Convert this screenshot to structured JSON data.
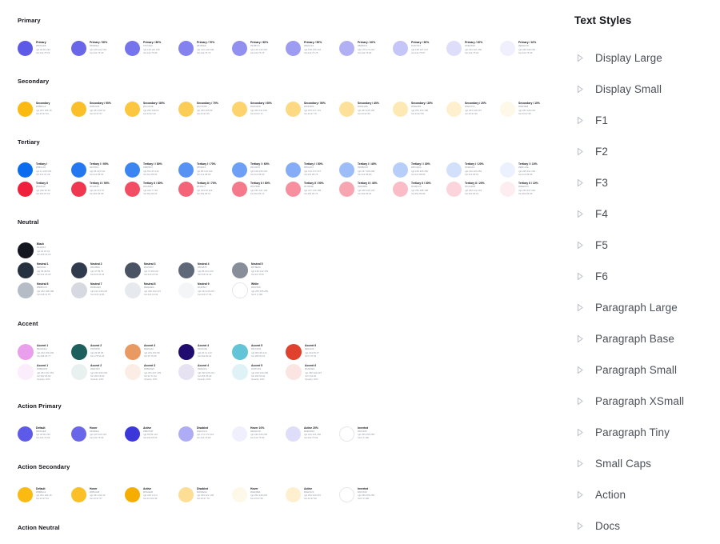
{
  "panels": {
    "text_styles": {
      "title": "Text Styles",
      "caret_icon": "triangle-right-icon",
      "items": [
        {
          "label": "Display Large"
        },
        {
          "label": "Display Small"
        },
        {
          "label": "F1"
        },
        {
          "label": "F2"
        },
        {
          "label": "F3"
        },
        {
          "label": "F4"
        },
        {
          "label": "F5"
        },
        {
          "label": "F6"
        },
        {
          "label": "Paragraph Large"
        },
        {
          "label": "Paragraph Base"
        },
        {
          "label": "Paragraph Small"
        },
        {
          "label": "Paragraph XSmall"
        },
        {
          "label": "Paragraph Tiny"
        },
        {
          "label": "Small Caps"
        },
        {
          "label": "Action"
        },
        {
          "label": "Docs"
        }
      ]
    }
  },
  "color_sections": [
    {
      "title": "Primary",
      "rows": [
        [
          {
            "name": "Primary",
            "hex": "#5D5AE8",
            "rgb": "rgb 93 90 232",
            "hsl": "hsl 242 75 63"
          },
          {
            "name": "Primary / 90%",
            "hex": "#6966EA",
            "rgb": "rgb 105 102 234",
            "hsl": "hsl 242 75 66"
          },
          {
            "name": "Primary / 80%",
            "hex": "#7674EC",
            "rgb": "rgb 118 116 236",
            "hsl": "hsl 242 75 69"
          },
          {
            "name": "Primary / 70%",
            "hex": "#8482EE",
            "rgb": "rgb 132 130 238",
            "hsl": "hsl 242 75 72"
          },
          {
            "name": "Primary / 60%",
            "hex": "#918FF0",
            "rgb": "rgb 145 143 240",
            "hsl": "hsl 242 75 75"
          },
          {
            "name": "Primary / 50%",
            "hex": "#9E9CF2",
            "rgb": "rgb 158 156 242",
            "hsl": "hsl 242 75 78"
          },
          {
            "name": "Primary / 40%",
            "hex": "#B2B0F4",
            "rgb": "rgb 178 176 244",
            "hsl": "hsl 242 75 82"
          },
          {
            "name": "Primary / 30%",
            "hex": "#C6C5F7",
            "rgb": "rgb 198 197 247",
            "hsl": "hsl 242 75 87"
          },
          {
            "name": "Primary / 20%",
            "hex": "#DEDDFA",
            "rgb": "rgb 222 221 250",
            "hsl": "hsl 242 75 92"
          },
          {
            "name": "Primary / 10%",
            "hex": "#EFEFFD",
            "rgb": "rgb 239 239 253",
            "hsl": "hsl 242 75 96"
          }
        ]
      ]
    },
    {
      "title": "Secondary",
      "rows": [
        [
          {
            "name": "Secondary",
            "hex": "#FBBA12",
            "rgb": "rgb 251 186 18",
            "hsl": "hsl 43 97 53"
          },
          {
            "name": "Secondary / 90%",
            "hex": "#FBC028",
            "rgb": "rgb 251 192 40",
            "hsl": "hsl 43 97 57"
          },
          {
            "name": "Secondary / 80%",
            "hex": "#FCC63E",
            "rgb": "rgb 252 198 62",
            "hsl": "hsl 43 97 62"
          },
          {
            "name": "Secondary / 70%",
            "hex": "#FCCD56",
            "rgb": "rgb 252 205 86",
            "hsl": "hsl 43 97 66"
          },
          {
            "name": "Secondary / 60%",
            "hex": "#FDD36D",
            "rgb": "rgb 253 211 109",
            "hsl": "hsl 43 97 71"
          },
          {
            "name": "Secondary / 50%",
            "hex": "#FDD983",
            "rgb": "rgb 253 217 131",
            "hsl": "hsl 43 97 75"
          },
          {
            "name": "Secondary / 40%",
            "hex": "#FDE19B",
            "rgb": "rgb 253 225 155",
            "hsl": "hsl 43 97 80"
          },
          {
            "name": "Secondary / 30%",
            "hex": "#FEE8B4",
            "rgb": "rgb 254 232 180",
            "hsl": "hsl 43 97 85"
          },
          {
            "name": "Secondary / 20%",
            "hex": "#FEF0CF",
            "rgb": "rgb 254 240 207",
            "hsl": "hsl 43 97 90"
          },
          {
            "name": "Secondary / 10%",
            "hex": "#FEF8E8",
            "rgb": "rgb 254 248 232",
            "hsl": "hsl 43 97 95"
          }
        ]
      ]
    },
    {
      "title": "Tertiary",
      "rows": [
        [
          {
            "name": "Tertiary I",
            "hex": "#0B6CF0",
            "rgb": "rgb 11 108 240",
            "hsl": "hsl 214 91 49"
          },
          {
            "name": "Tertiary I / 90%",
            "hex": "#2378F1",
            "rgb": "rgb 35 120 241",
            "hsl": "hsl 214 88 54"
          },
          {
            "name": "Tertiary I / 80%",
            "hex": "#3B85F3",
            "rgb": "rgb 59 133 243",
            "hsl": "hsl 214 88 59"
          },
          {
            "name": "Tertiary I / 70%",
            "hex": "#5592F4",
            "rgb": "rgb 85 146 244",
            "hsl": "hsl 214 88 65"
          },
          {
            "name": "Tertiary I / 60%",
            "hex": "#6C9FF5",
            "rgb": "rgb 108 159 245",
            "hsl": "hsl 214 88 69"
          },
          {
            "name": "Tertiary I / 50%",
            "hex": "#85ADF7",
            "rgb": "rgb 133 173 247",
            "hsl": "hsl 214 88 75"
          },
          {
            "name": "Tertiary I / 40%",
            "hex": "#9DBDF8",
            "rgb": "rgb 157 189 248",
            "hsl": "hsl 214 88 80"
          },
          {
            "name": "Tertiary I / 30%",
            "hex": "#B7CEFA",
            "rgb": "rgb 183 206 250",
            "hsl": "hsl 214 88 85"
          },
          {
            "name": "Tertiary I / 20%",
            "hex": "#D2E0FC",
            "rgb": "rgb 210 224 252",
            "hsl": "hsl 214 88 91"
          },
          {
            "name": "Tertiary I / 10%",
            "hex": "#EBF1FE",
            "rgb": "rgb 235 241 254",
            "hsl": "hsl 214 88 96"
          }
        ],
        [
          {
            "name": "Tertiary II",
            "hex": "#F0203C",
            "rgb": "rgb 240 32 60",
            "hsl": "hsl 352 87 53"
          },
          {
            "name": "Tertiary II / 90%",
            "hex": "#F1364F",
            "rgb": "rgb 241 54 79",
            "hsl": "hsl 352 86 58"
          },
          {
            "name": "Tertiary II / 80%",
            "hex": "#F24D63",
            "rgb": "rgb 242 77 99",
            "hsl": "hsl 352 86 63"
          },
          {
            "name": "Tertiary II / 70%",
            "hex": "#F46377",
            "rgb": "rgb 244 99 119",
            "hsl": "hsl 352 86 67"
          },
          {
            "name": "Tertiary II / 60%",
            "hex": "#F5798B",
            "rgb": "rgb 245 121 139",
            "hsl": "hsl 352 86 72"
          },
          {
            "name": "Tertiary II / 50%",
            "hex": "#F78F9E",
            "rgb": "rgb 247 143 158",
            "hsl": "hsl 352 86 76"
          },
          {
            "name": "Tertiary II / 40%",
            "hex": "#F8A5B2",
            "rgb": "rgb 248 165 178",
            "hsl": "hsl 352 86 81"
          },
          {
            "name": "Tertiary II / 30%",
            "hex": "#FABCC6",
            "rgb": "rgb 250 188 198",
            "hsl": "hsl 352 86 86"
          },
          {
            "name": "Tertiary II / 20%",
            "hex": "#FCD4DB",
            "rgb": "rgb 252 212 219",
            "hsl": "hsl 352 86 91"
          },
          {
            "name": "Tertiary II / 10%",
            "hex": "#FEEDF0",
            "rgb": "rgb 254 237 240",
            "hsl": "hsl 352 86 96"
          }
        ]
      ]
    },
    {
      "title": "Neutral",
      "rows": [
        [
          {
            "name": "Black",
            "hex": "#14161F",
            "rgb": "rgb 20 22 31",
            "hsl": "hsl 229 22 10"
          }
        ],
        [
          {
            "name": "Neutral 1",
            "hex": "#26313F",
            "rgb": "rgb 38 49 63",
            "hsl": "hsl 214 25 20"
          },
          {
            "name": "Neutral 2",
            "hex": "#2F3B4C",
            "rgb": "rgb 47 59 76",
            "hsl": "hsl 215 24 24"
          },
          {
            "name": "Neutral 3",
            "hex": "#4A5364",
            "rgb": "rgb 74 83 100",
            "hsl": "hsl 219 15 34"
          },
          {
            "name": "Neutral 4",
            "hex": "#5F6878",
            "rgb": "rgb 95 104 120",
            "hsl": "hsl 218 12 42"
          },
          {
            "name": "Neutral 5",
            "hex": "#878E99",
            "rgb": "rgb 135 142 153",
            "hsl": "hsl 217 8 56"
          }
        ],
        [
          {
            "name": "Neutral 6",
            "hex": "#B6BCC6",
            "rgb": "rgb 182 188 198",
            "hsl": "hsl 218 11 75"
          },
          {
            "name": "Neutral 7",
            "hex": "#D6DAE0",
            "rgb": "rgb 214 218 224",
            "hsl": "hsl 216 12 86"
          },
          {
            "name": "Neutral 8",
            "hex": "#E6E9ED",
            "rgb": "rgb 230 233 237",
            "hsl": "hsl 214 13 92"
          },
          {
            "name": "Neutral 9",
            "hex": "#F3F5F7",
            "rgb": "rgb 243 245 247",
            "hsl": "hsl 210 17 96"
          },
          {
            "name": "White",
            "hex": "#FFFFFF",
            "rgb": "rgb 255 255 255",
            "hsl": "hsl 0 0 100"
          }
        ]
      ]
    },
    {
      "title": "Accent",
      "rows": [
        [
          {
            "name": "Accent 1",
            "hex": "#EA9FEC",
            "rgb": "rgb 234 159 236",
            "hsl": "hsl 298 66 77"
          },
          {
            "name": "Accent 2",
            "hex": "#1D5F5D",
            "rgb": "rgb 29 95 93",
            "hsl": "hsl 178 53 24"
          },
          {
            "name": "Accent 3",
            "hex": "#E99A62",
            "rgb": "rgb 233 154 98",
            "hsl": "hsl 25 76 65"
          },
          {
            "name": "Accent 4",
            "hex": "#200C6E",
            "rgb": "rgb 32 12 110",
            "hsl": "hsl 252 80 24"
          },
          {
            "name": "Accent 5",
            "hex": "#62C4D6",
            "rgb": "rgb 98 196 214",
            "hsl": "hsl 189 60 61"
          },
          {
            "name": "Accent 6",
            "hex": "#E0412F",
            "rgb": "rgb 224 65 47",
            "hsl": "hsl 6 75 53"
          }
        ],
        [
          {
            "name": "Accent 1",
            "hex": "#FBEDFB",
            "rgb": "rgb 251 237 251",
            "hsl": "hsl 300 65 96",
            "opacity": "Opacity 10%"
          },
          {
            "name": "Accent 2",
            "hex": "#E9F0F0",
            "rgb": "rgb 233 240 240",
            "hsl": "hsl 180 18 93",
            "opacity": "Opacity 10%"
          },
          {
            "name": "Accent 3",
            "hex": "#FBEDE5",
            "rgb": "rgb 251 237 229",
            "hsl": "hsl 22 71 94",
            "opacity": "Opacity 10%"
          },
          {
            "name": "Accent 4",
            "hex": "#E6E2F1",
            "rgb": "rgb 230 226 241",
            "hsl": "hsl 256 35 92",
            "opacity": "Opacity 10%"
          },
          {
            "name": "Accent 5",
            "hex": "#DFF2F6",
            "rgb": "rgb 223 242 246",
            "hsl": "hsl 190 53 92",
            "opacity": "Opacity 10%"
          },
          {
            "name": "Accent 6",
            "hex": "#FAE5E3",
            "rgb": "rgb 250 229 227",
            "hsl": "hsl 5 64 94",
            "opacity": "Opacity 10%"
          }
        ]
      ]
    },
    {
      "title": "Action Primary",
      "rows": [
        [
          {
            "name": "Default",
            "hex": "#5D5AE8",
            "rgb": "rgb 93 90 232",
            "hsl": "hsl 242 75 63"
          },
          {
            "name": "Hover",
            "hex": "#6966EA",
            "rgb": "rgb 105 102 234",
            "hsl": "hsl 242 75 66"
          },
          {
            "name": "Active",
            "hex": "#3B37D8",
            "rgb": "rgb 59 55 216",
            "hsl": "hsl 242 66 53"
          },
          {
            "name": "Disabled",
            "hex": "#AEACF4",
            "rgb": "rgb 174 172 244",
            "hsl": "hsl 242 75 82"
          },
          {
            "name": "Hover 10%",
            "hex": "#EFEFFD",
            "rgb": "rgb 239 239 253",
            "hsl": "hsl 242 75 96"
          },
          {
            "name": "Active 20%",
            "hex": "#DEDDFA",
            "rgb": "rgb 222 221 250",
            "hsl": "hsl 242 75 92"
          },
          {
            "name": "Inverted",
            "hex": "#FFFFFF",
            "rgb": "rgb 255 255 255",
            "hsl": "hsl 0 0 100"
          }
        ]
      ]
    },
    {
      "title": "Action Secondary",
      "rows": [
        [
          {
            "name": "Default",
            "hex": "#FBBA12",
            "rgb": "rgb 251 186 18",
            "hsl": "hsl 43 97 53"
          },
          {
            "name": "Hover",
            "hex": "#FBC028",
            "rgb": "rgb 251 192 40",
            "hsl": "hsl 43 97 57"
          },
          {
            "name": "Active",
            "hex": "#F5AE00",
            "rgb": "rgb 245 174 0",
            "hsl": "hsl 43 100 48"
          },
          {
            "name": "Disabled",
            "hex": "#FDDE94",
            "rgb": "rgb 253 222 148",
            "hsl": "hsl 43 97 79"
          },
          {
            "name": "Hover",
            "hex": "#FEF8E8",
            "rgb": "rgb 254 248 232",
            "hsl": "hsl 43 97 95"
          },
          {
            "name": "Active",
            "hex": "#FEF0CF",
            "rgb": "rgb 254 240 207",
            "hsl": "hsl 43 97 90"
          },
          {
            "name": "Inverted",
            "hex": "#FFFFFF",
            "rgb": "rgb 255 255 255",
            "hsl": "hsl 0 0 100"
          }
        ]
      ]
    },
    {
      "title": "Action Neutral",
      "rows": []
    }
  ]
}
